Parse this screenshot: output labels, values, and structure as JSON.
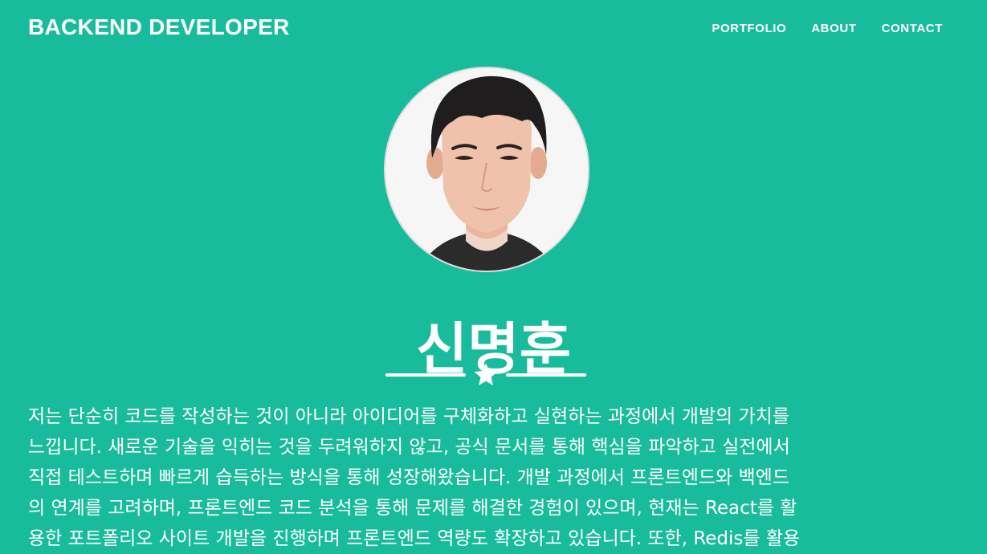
{
  "navbar": {
    "brand": "BACKEND DEVELOPER",
    "links": [
      "PORTFOLIO",
      "ABOUT",
      "CONTACT"
    ]
  },
  "profile": {
    "name": "신명훈",
    "photo_icon": "profile-photo",
    "divider_icon": "star-icon"
  },
  "intro": {
    "lines": [
      "저는 단순히 코드를 작성하는 것이 아니라 아이디어를 구체화하고 실현하는 과정에서 개발의 가치를",
      "느낍니다. 새로운 기술을 익히는 것을 두려워하지 않고, 공식 문서를 통해 핵심을 파악하고 실전에서",
      "직접 테스트하며 빠르게 습득하는 방식을 통해 성장해왔습니다. 개발 과정에서 프론트엔드와 백엔드",
      "의 연계를 고려하며, 프론트엔드 코드 분석을 통해 문제를 해결한 경험이 있으며, 현재는 React를 활",
      "용한 포트폴리오 사이트 개발을 진행하며 프론트엔드 역량도 확장하고 있습니다. 또한, Redis를 활용"
    ]
  },
  "colors": {
    "background": "#18bc9c",
    "text": "#ffffff"
  }
}
